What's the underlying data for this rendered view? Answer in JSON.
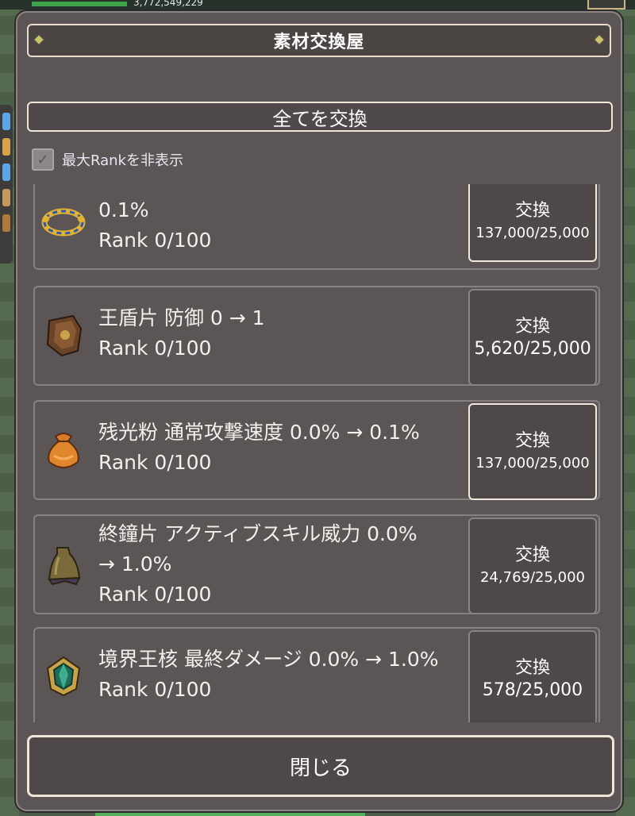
{
  "hud": {
    "money": "3,772,549,229"
  },
  "dialog": {
    "title": "素材交換屋",
    "exchange_all_label": "全てを交換",
    "hide_max_rank_label": "最大Rankを非表示",
    "hide_max_rank_checked": true,
    "close_label": "閉じる"
  },
  "items": [
    {
      "line1": "",
      "line2": "0.1%",
      "rank": "Rank 0/100",
      "button_label": "交換",
      "count": "137,000/25,000",
      "highlight": true,
      "icon": "ring-icon"
    },
    {
      "line1": "王盾片  防御 0 → 1",
      "line2": "",
      "rank": "Rank 0/100",
      "button_label": "交換",
      "count": "5,620/25,000",
      "highlight": false,
      "icon": "shield-fragment-icon"
    },
    {
      "line1": "残光粉  通常攻撃速度 0.0% → 0.1%",
      "line2": "",
      "rank": "Rank 0/100",
      "button_label": "交換",
      "count": "137,000/25,000",
      "highlight": true,
      "icon": "powder-bag-icon"
    },
    {
      "line1": "終鐘片  アクティブスキル威力 0.0%",
      "line2": "→ 1.0%",
      "rank": "Rank 0/100",
      "button_label": "交換",
      "count": "24,769/25,000",
      "highlight": false,
      "icon": "bell-fragment-icon"
    },
    {
      "line1": "境界王核  最終ダメージ 0.0% → 1.0%",
      "line2": "",
      "rank": "Rank 0/100",
      "button_label": "交換",
      "count": "578/25,000",
      "highlight": false,
      "icon": "gem-core-icon"
    }
  ]
}
